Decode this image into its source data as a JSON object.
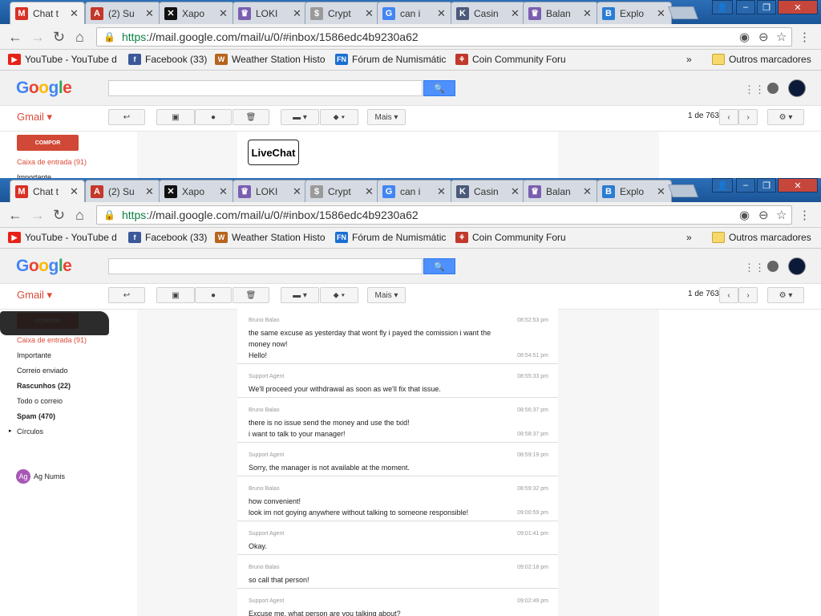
{
  "tabs": [
    {
      "title": "Chat t",
      "fav": "gmail-icon",
      "color": "#d93025",
      "glyph": "M"
    },
    {
      "title": "(2) Su",
      "fav": "a-icon",
      "color": "#c4372b",
      "glyph": "A"
    },
    {
      "title": "Xapo",
      "fav": "xapo-icon",
      "color": "#111111",
      "glyph": "✕"
    },
    {
      "title": "LOKI",
      "fav": "gift-icon",
      "color": "#7a5fb0",
      "glyph": "♛"
    },
    {
      "title": "Crypt",
      "fav": "coin-icon",
      "color": "#9a9a9a",
      "glyph": "$"
    },
    {
      "title": "can i",
      "fav": "google-icon",
      "color": "#4285f4",
      "glyph": "G"
    },
    {
      "title": "Casin",
      "fav": "k-icon",
      "color": "#4b5a7a",
      "glyph": "K"
    },
    {
      "title": "Balan",
      "fav": "gift-icon",
      "color": "#7a5fb0",
      "glyph": "♛"
    },
    {
      "title": "Explo",
      "fav": "b-icon",
      "color": "#2b7cd3",
      "glyph": "B"
    }
  ],
  "url": {
    "scheme": "https",
    "rest": "://mail.google.com/mail/u/0/#inbox/1586edc4b9230a62"
  },
  "bookmarks": [
    {
      "label": "YouTube - YouTube d",
      "color": "#e62117",
      "glyph": "▶"
    },
    {
      "label": "Facebook (33)",
      "color": "#3b5998",
      "glyph": "f"
    },
    {
      "label": "Weather Station Histo",
      "color": "#b5651d",
      "glyph": "W"
    },
    {
      "label": "Fórum de Numismátic",
      "color": "#1a6fd1",
      "glyph": "FN"
    },
    {
      "label": "Coin Community Foru",
      "color": "#c0392b",
      "glyph": "⚘"
    }
  ],
  "bookmarks_more": "»",
  "bookmarks_other": "Outros marcadores",
  "google_logo": "Google",
  "gmail_label": "Gmail ▾",
  "more_button": "Mais ▾",
  "page_count": "1 de 763",
  "compose": "COMPOR",
  "nav": [
    "Caixa de entrada (91)",
    "Importante",
    "Correio enviado",
    "Rascunhos (22)",
    "Todo o correio",
    "Spam (470)",
    "Círculos"
  ],
  "nav_partial": "Importante",
  "contact": {
    "initials": "Ag",
    "name": "Ag Numis"
  },
  "livechat": "LiveChat",
  "messages": [
    {
      "sender": "Bruno Balao",
      "lines": [
        "the same excuse as yesterday that wont fly i payed the comission i want the",
        "money now!",
        "Hello!"
      ],
      "times": [
        "08:52:53 pm",
        "08:54:51 pm"
      ]
    },
    {
      "sender": "Support Agent",
      "lines": [
        "We'll proceed your withdrawal as soon as we'll fix that issue."
      ],
      "times": [
        "08:55:33 pm"
      ]
    },
    {
      "sender": "Bruno Balao",
      "lines": [
        "there is no issue send the money and use the txid!",
        "i want to talk to your manager!"
      ],
      "times": [
        "08:56:37 pm",
        "08:58:37 pm"
      ]
    },
    {
      "sender": "Support Agent",
      "lines": [
        "Sorry, the manager is not available at the moment."
      ],
      "times": [
        "08:59:19 pm"
      ]
    },
    {
      "sender": "Bruno Balao",
      "lines": [
        "how convenient!",
        "look im not goying anywhere without talking to someone responsible!"
      ],
      "times": [
        "08:59:32 pm",
        "09:00:59 pm"
      ]
    },
    {
      "sender": "Support Agent",
      "lines": [
        "Okay."
      ],
      "times": [
        "09:01:41 pm"
      ]
    },
    {
      "sender": "Bruno Balao",
      "lines": [
        "so call that person!"
      ],
      "times": [
        "09:02:18 pm"
      ]
    },
    {
      "sender": "Support Agent",
      "lines": [
        "Excuse me, what person are you talking about?"
      ],
      "times": [
        "09:02:49 pm"
      ]
    }
  ]
}
